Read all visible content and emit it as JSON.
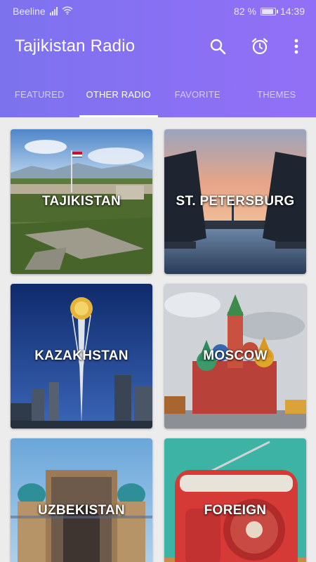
{
  "status_bar": {
    "carrier": "Beeline",
    "battery_percent": "82 %",
    "battery_level": 0.82,
    "time": "14:39"
  },
  "app_bar": {
    "title": "Tajikistan Radio",
    "icons": [
      "search-icon",
      "alarm-icon",
      "more-vert-icon"
    ]
  },
  "tabs": [
    {
      "label": "FEATURED",
      "active": false
    },
    {
      "label": "OTHER RADIO",
      "active": true
    },
    {
      "label": "FAVORITE",
      "active": false
    },
    {
      "label": "THEMES",
      "active": false
    }
  ],
  "cards": [
    {
      "label": "TAJIKISTAN"
    },
    {
      "label": "ST. PETERSBURG"
    },
    {
      "label": "KAZAKHSTAN"
    },
    {
      "label": "MOSCOW"
    },
    {
      "label": "UZBEKISTAN"
    },
    {
      "label": "FOREIGN"
    }
  ],
  "colors": {
    "header": "#8472f2",
    "tab_active": "#ffffff",
    "tab_inactive": "#d3cdfb",
    "background": "#ececec"
  }
}
